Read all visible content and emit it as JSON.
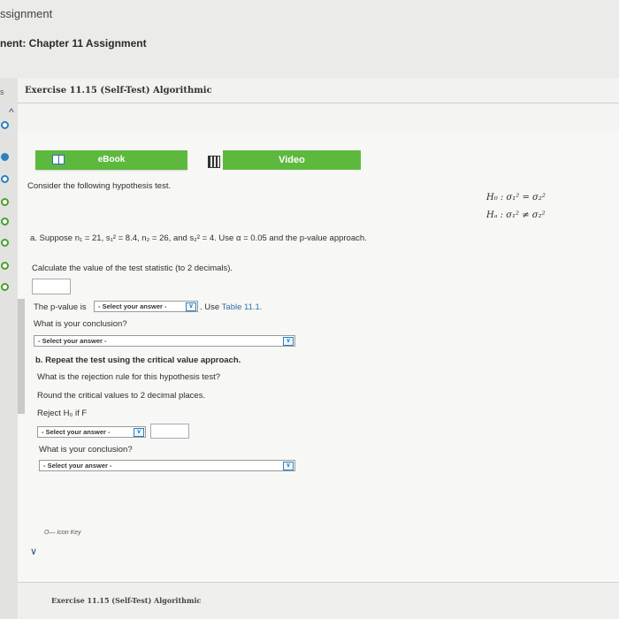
{
  "window": {
    "assignment_title": "ssignment",
    "chapter_title": "nent: Chapter 11 Assignment",
    "left_label": "s"
  },
  "exercise": {
    "title": "Exercise 11.15 (Self-Test) Algorithmic",
    "ebook_label": "eBook",
    "video_label": "Video",
    "intro": "Consider the following hypothesis test.",
    "h0": "H₀ : σ₁² = σ₂²",
    "ha": "Hₐ : σ₁² ≠ σ₂²",
    "part_a": "a. Suppose n₁ = 21, s₁² = 8.4, n₂ = 26, and s₂² = 4. Use α = 0.05 and the p-value approach.",
    "calc_prompt": "Calculate the value of the test statistic (to 2 decimals).",
    "pvalue_prefix": "The p-value is",
    "pvalue_select": "- Select your answer -",
    "use_prefix": ". Use",
    "table_link": "Table 11.1.",
    "conclusion_q": "What is your conclusion?",
    "conclusion_select_a": "- Select your answer -",
    "part_b": "b. Repeat the test using the critical value approach.",
    "rejection_q": "What is the rejection rule for this hypothesis test?",
    "round_note": "Round the critical values to 2 decimal places.",
    "reject_label": "Reject H₀ if F",
    "reject_select": "- Select your answer -",
    "conclusion_q_b": "What is your conclusion?",
    "conclusion_select_b": "- Select your answer -",
    "icon_key": "O— Icon Key",
    "footer_title": "Exercise 11.15 (Self-Test) Algorithmic"
  }
}
